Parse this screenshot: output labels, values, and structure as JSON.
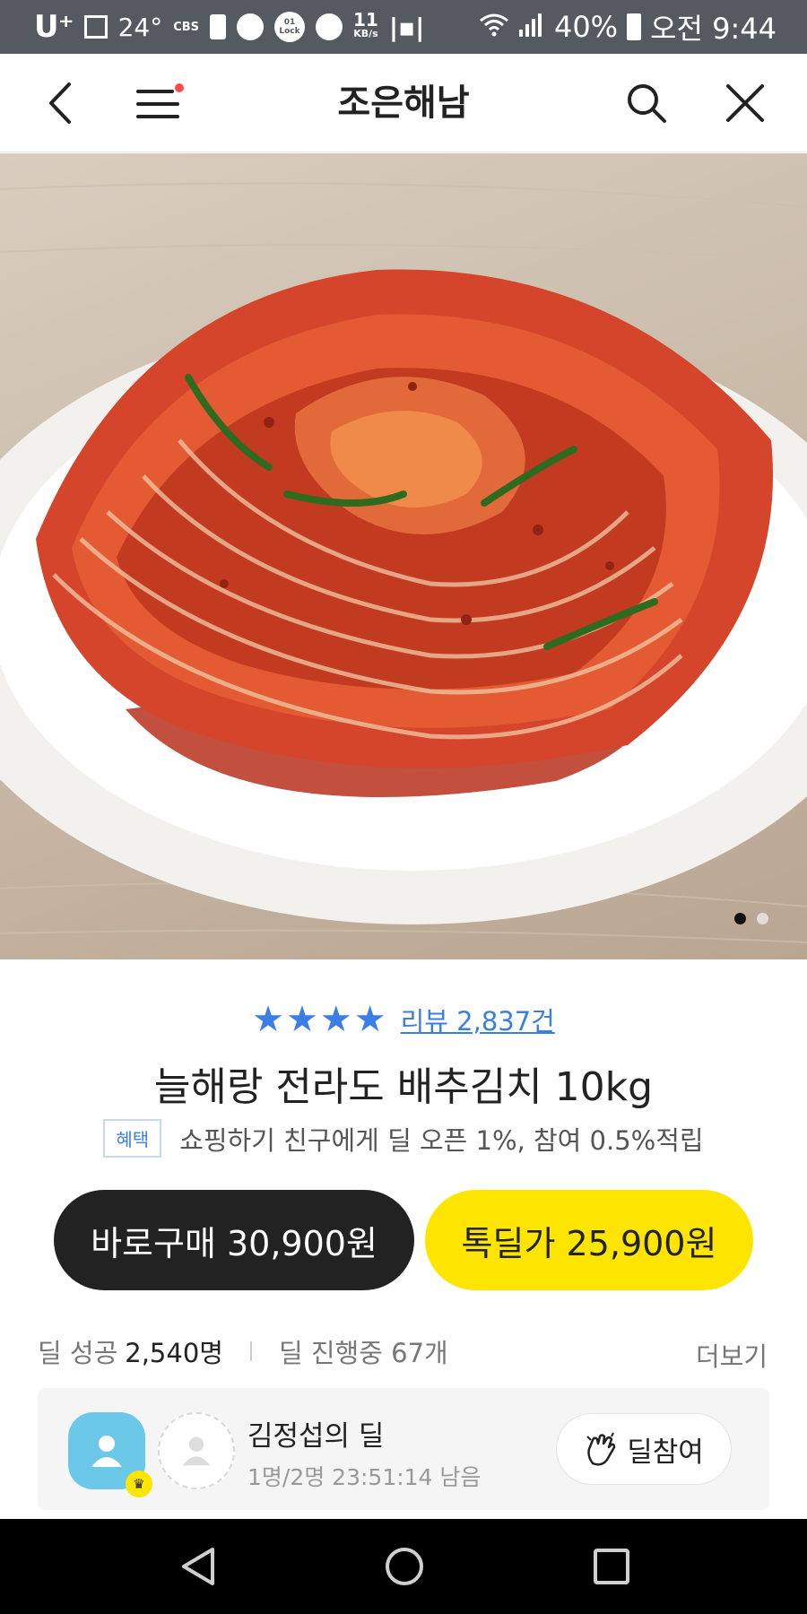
{
  "status_bar": {
    "carrier": "U⁺",
    "temperature": "24°",
    "radio": "CBS",
    "lock_label": "01 Lock",
    "speed_value": "11",
    "speed_unit": "KB/s",
    "battery": "40%",
    "time": "오전 9:44"
  },
  "header": {
    "title": "조은해남",
    "icons": [
      "back-arrow-icon",
      "menu-icon",
      "search-icon",
      "close-icon"
    ],
    "notification_dot_color": "#ff4b4b"
  },
  "product": {
    "image_description_colors": [
      "#d9cdbf",
      "#ffffff",
      "#c4311b"
    ],
    "carousel_pages": 2,
    "carousel_active_index": 0,
    "rating_stars": 4,
    "review_link": "리뷰 2,837건",
    "title": "늘해랑 전라도 배추김치 10kg",
    "benefit_badge": "혜택",
    "benefit_text": "쇼핑하기 친구에게 딜 오픈 1%, 참여 0.5%적립"
  },
  "actions": {
    "buy_now": "바로구매 30,900원",
    "talk_deal": "톡딜가 25,900원",
    "buy_now_color": "#222222",
    "talk_deal_color": "#fee500"
  },
  "deal_stats": {
    "success_label": "딜 성공",
    "success_value": "2,540명",
    "ongoing": "딜 진행중 67개",
    "more": "더보기"
  },
  "deal_card": {
    "owner": "김정섭의 딜",
    "progress": "1명/2명  23:51:14 남음",
    "join_label": "딜참여",
    "accent_color": "#6cc8e8"
  },
  "nav_bar": {
    "icons": [
      "nav-back-icon",
      "nav-home-icon",
      "nav-recent-icon"
    ]
  }
}
